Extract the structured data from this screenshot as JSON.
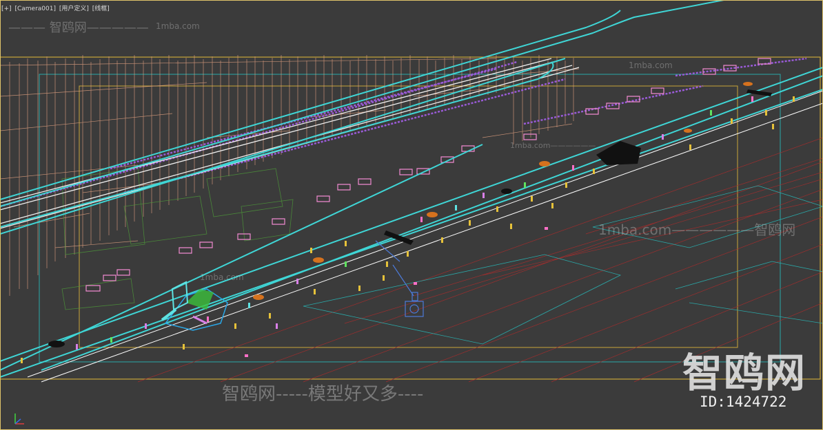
{
  "viewport": {
    "label_plus": "[+]",
    "label_camera": "[Camera001]",
    "label_view": "[用户定义]",
    "label_shading": "[线框]"
  },
  "watermarks": {
    "top": "——— 智鸥网—————",
    "top_url": "1mba.com",
    "mid1": "1mba.com",
    "mid2": "1mba.com——————",
    "mid3": "1mba.com——————智鸥网",
    "mid4": "1mba.com",
    "bottom": "智鸥网-----模型好又多----",
    "logo": "智鸥网",
    "id": "ID:1424722"
  },
  "colors": {
    "background": "#3b3b3b",
    "road_cyan": "#3fd6d6",
    "building_salmon": "#e8a583",
    "tree_purple": "#9a5bd8",
    "outline_yellow": "#c9a63a",
    "outline_teal": "#2aa8a8"
  }
}
